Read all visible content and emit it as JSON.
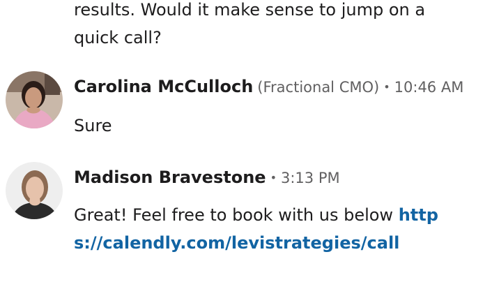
{
  "previous_message": {
    "body_text": "results. Would it make sense to jump on a quick call?"
  },
  "messages": [
    {
      "author": "Carolina McCulloch",
      "author_title": "(Fractional CMO)",
      "separator": "•",
      "timestamp": "10:46 AM",
      "text": "Sure"
    },
    {
      "author": "Madison Bravestone",
      "separator": "•",
      "timestamp": "3:13 PM",
      "text_before_link": "Great! Feel free to book with us below ",
      "link_text": "https://calendly.com/levistrategies/call"
    }
  ],
  "colors": {
    "text": "#1d1c1d",
    "muted": "#616061",
    "link": "#1264a3"
  }
}
